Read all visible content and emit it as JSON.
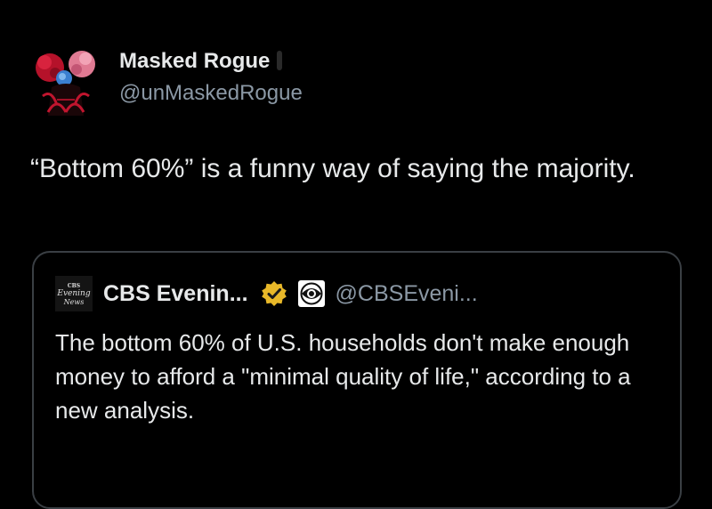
{
  "tweet": {
    "author": {
      "display_name": "Masked Rogue",
      "handle": "@unMaskedRogue",
      "avatar_icon": "masked-figure-avatar"
    },
    "text": "“Bottom 60%” is a funny way of saying the majority."
  },
  "quote": {
    "logo_lines": [
      "CBS",
      "Evening",
      "News"
    ],
    "display_name": "CBS Evenin...",
    "verified_icon": "gold-verified-badge",
    "affiliate_icon": "cbs-eye-icon",
    "handle": "@CBSEveni...",
    "text": "The bottom 60% of U.S. households don't make enough money to afford a \"minimal quality of life,\" according to a new analysis."
  },
  "colors": {
    "background": "#000000",
    "text_primary": "#e7e9ea",
    "text_secondary": "#8b98a5",
    "card_border": "#3a3f44",
    "verified_gold": "#e8b829"
  }
}
